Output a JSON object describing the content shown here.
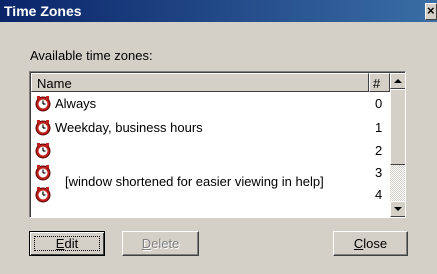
{
  "window": {
    "title": "Time Zones",
    "close_glyph": "×"
  },
  "available_label": "Available time zones:",
  "list": {
    "columns": [
      "Name",
      "#"
    ],
    "rows": [
      {
        "name": "Always",
        "num": "0",
        "icon": "clock-icon"
      },
      {
        "name": "Weekday, business hours",
        "num": "1",
        "icon": "clock-icon"
      },
      {
        "name": "",
        "num": "2",
        "icon": "clock-icon"
      },
      {
        "name": "",
        "num": "3",
        "icon": "clock-icon"
      },
      {
        "name": "",
        "num": "4",
        "icon": "clock-icon"
      }
    ],
    "note": "[window shortened for easier viewing in help]"
  },
  "buttons": {
    "edit": {
      "mnemonic": "E",
      "rest": "dit"
    },
    "delete": {
      "mnemonic": "D",
      "rest": "elete"
    },
    "close": {
      "mnemonic": "C",
      "rest": "lose"
    }
  },
  "colors": {
    "titlebar": "#0a246a",
    "face": "#d4d0c8",
    "clock_red": "#c0201c"
  }
}
